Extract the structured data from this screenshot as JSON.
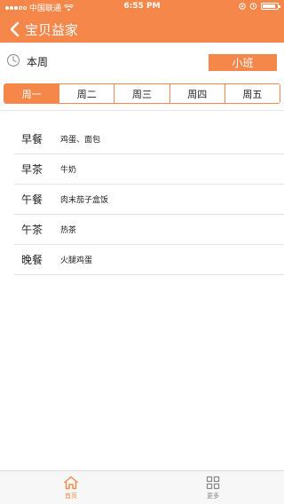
{
  "status_bar": {
    "carrier": "中国联通",
    "time": "6:55 PM",
    "battery_level": 0.9
  },
  "navbar": {
    "title": "宝贝益家",
    "back_icon": "chevron-left-icon"
  },
  "week": {
    "label": "本周",
    "class_button": "小班"
  },
  "tabs": [
    {
      "label": "周一",
      "active": true
    },
    {
      "label": "周二",
      "active": false
    },
    {
      "label": "周三",
      "active": false
    },
    {
      "label": "周四",
      "active": false
    },
    {
      "label": "周五",
      "active": false
    }
  ],
  "meals": [
    {
      "name": "早餐",
      "food": "鸡蛋、面包"
    },
    {
      "name": "早茶",
      "food": "牛奶"
    },
    {
      "name": "午餐",
      "food": "肉末茄子盒饭"
    },
    {
      "name": "午茶",
      "food": "热茶"
    },
    {
      "name": "晚餐",
      "food": "火腿鸡蛋"
    }
  ],
  "bottom_nav": [
    {
      "label": "首页",
      "icon": "home-icon",
      "active": true
    },
    {
      "label": "更多",
      "icon": "grid-icon",
      "active": false
    }
  ],
  "colors": {
    "accent": "#f6874a",
    "divider": "#e4e4e4"
  }
}
